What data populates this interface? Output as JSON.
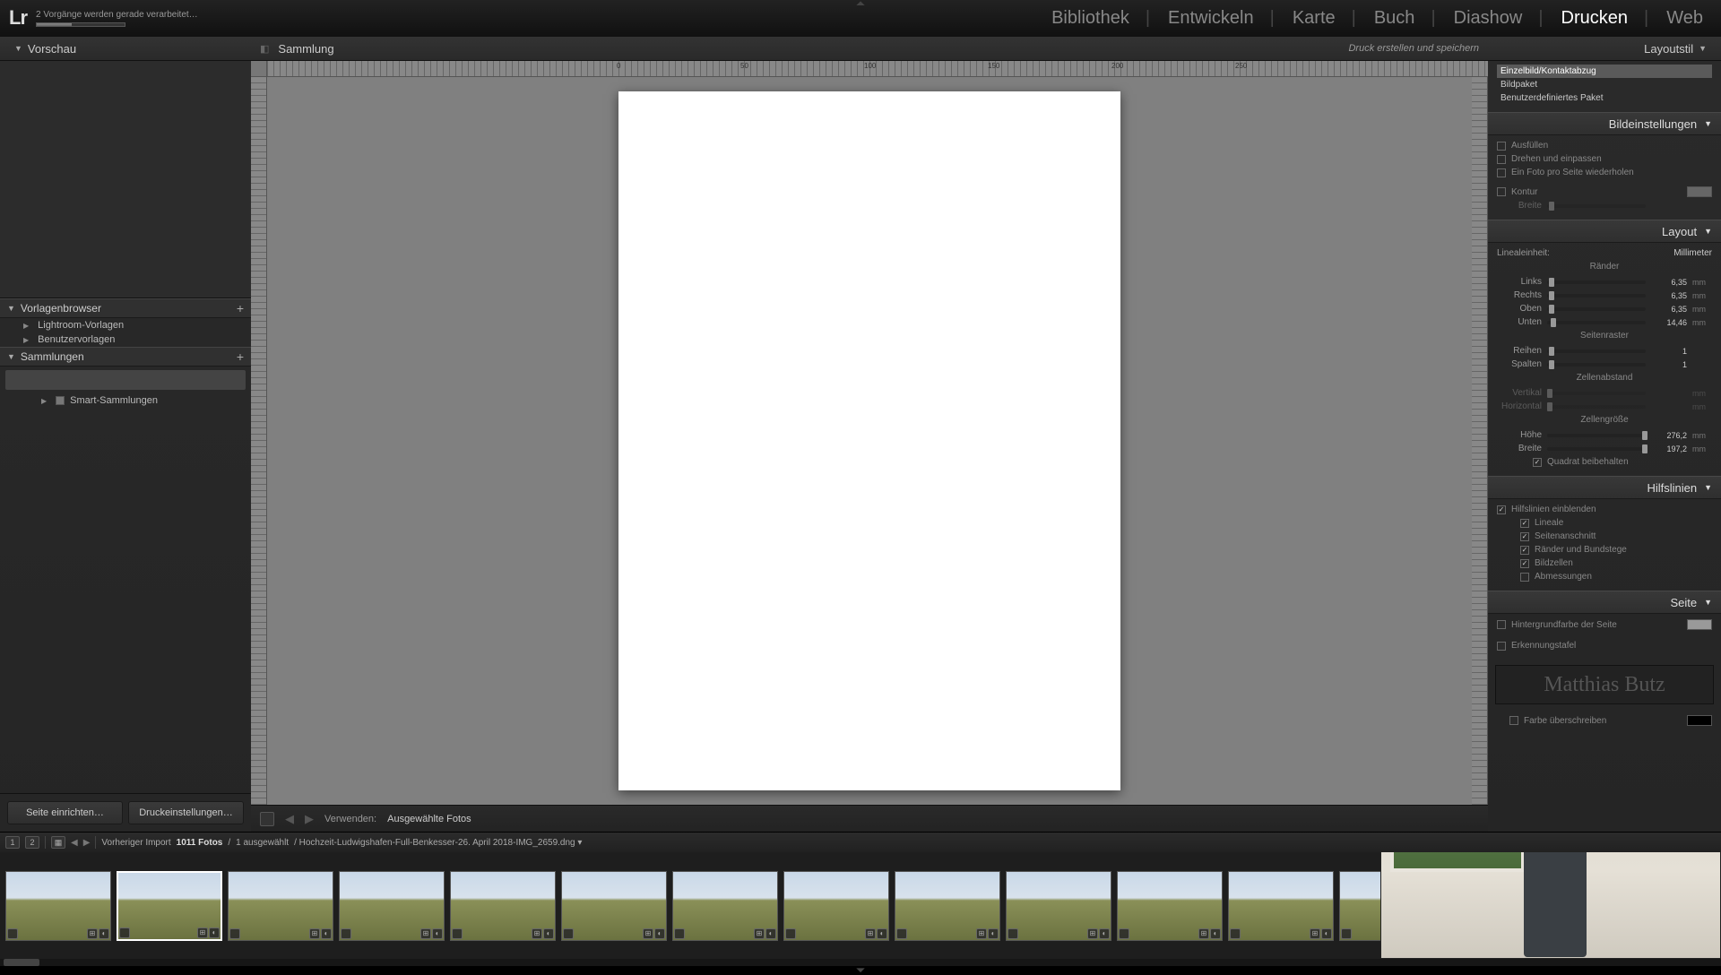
{
  "titlebar": {
    "logo": "Lr",
    "progress_text": "2 Vorgänge werden gerade verarbeitet…"
  },
  "modules": {
    "items": [
      "Bibliothek",
      "Entwickeln",
      "Karte",
      "Buch",
      "Diashow",
      "Drucken",
      "Web"
    ],
    "active": "Drucken"
  },
  "left": {
    "preview_header": "Vorschau",
    "vorlagen_header": "Vorlagenbrowser",
    "vorlagen_items": [
      "Lightroom-Vorlagen",
      "Benutzervorlagen"
    ],
    "sammlungen_header": "Sammlungen",
    "smart": "Smart-Sammlungen",
    "btn_page": "Seite einrichten…",
    "btn_print": "Druckeinstellungen…"
  },
  "center": {
    "collection_label": "Sammlung",
    "print_save": "Druck erstellen und speichern",
    "use_label": "Verwenden:",
    "use_value": "Ausgewählte Fotos",
    "ruler_nums": [
      "0",
      "50",
      "100",
      "150",
      "200",
      "250"
    ]
  },
  "right": {
    "layoutstil": "Layoutstil",
    "style_opts": [
      "Einzelbild/Kontaktabzug",
      "Bildpaket",
      "Benutzerdefiniertes Paket"
    ],
    "bildeinst": "Bildeinstellungen",
    "img_opts": [
      "Ausfüllen",
      "Drehen und einpassen",
      "Ein Foto pro Seite wiederholen"
    ],
    "kontur": "Kontur",
    "breite": "Breite",
    "layout": "Layout",
    "lineal": "Linealeinheit:",
    "lineal_val": "Millimeter",
    "raender": "Ränder",
    "margins": [
      {
        "lbl": "Links",
        "val": "6,35",
        "unit": "mm",
        "pos": 2
      },
      {
        "lbl": "Rechts",
        "val": "6,35",
        "unit": "mm",
        "pos": 2
      },
      {
        "lbl": "Oben",
        "val": "6,35",
        "unit": "mm",
        "pos": 2
      },
      {
        "lbl": "Unten",
        "val": "14,46",
        "unit": "mm",
        "pos": 4
      }
    ],
    "seitenraster": "Seitenraster",
    "grid": [
      {
        "lbl": "Reihen",
        "val": "1",
        "unit": "",
        "pos": 2
      },
      {
        "lbl": "Spalten",
        "val": "1",
        "unit": "",
        "pos": 2
      }
    ],
    "zellenabstand": "Zellenabstand",
    "spacing": [
      {
        "lbl": "Vertikal",
        "val": "",
        "unit": "mm",
        "pos": 0,
        "dim": true
      },
      {
        "lbl": "Horizontal",
        "val": "",
        "unit": "mm",
        "pos": 0,
        "dim": true
      }
    ],
    "zellengroesse": "Zellengröße",
    "cellsize": [
      {
        "lbl": "Höhe",
        "val": "276,2",
        "unit": "mm",
        "pos": 96
      },
      {
        "lbl": "Breite",
        "val": "197,2",
        "unit": "mm",
        "pos": 96
      }
    ],
    "quadrat": "Quadrat beibehalten",
    "hilfslinien": "Hilfslinien",
    "show_guides": "Hilfslinien einblenden",
    "guide_opts": [
      "Lineale",
      "Seitenanschnitt",
      "Ränder und Bundstege",
      "Bildzellen",
      "Abmessungen"
    ],
    "guide_checked": [
      true,
      true,
      true,
      true,
      false
    ],
    "seite": "Seite",
    "bgcolor": "Hintergrundfarbe der Seite",
    "erkennung": "Erkennungstafel",
    "watermark": "Matthias Butz",
    "farbe_ueber": "Farbe überschreiben"
  },
  "filmstrip": {
    "monitor": "1",
    "info1": "Vorheriger Import",
    "count": "1011 Fotos",
    "sep": "/",
    "selected": "1 ausgewählt",
    "path": "/ Hochzeit-Ludwigshafen-Full-Benkesser-26. April 2018-IMG_2659.dng ▾"
  }
}
